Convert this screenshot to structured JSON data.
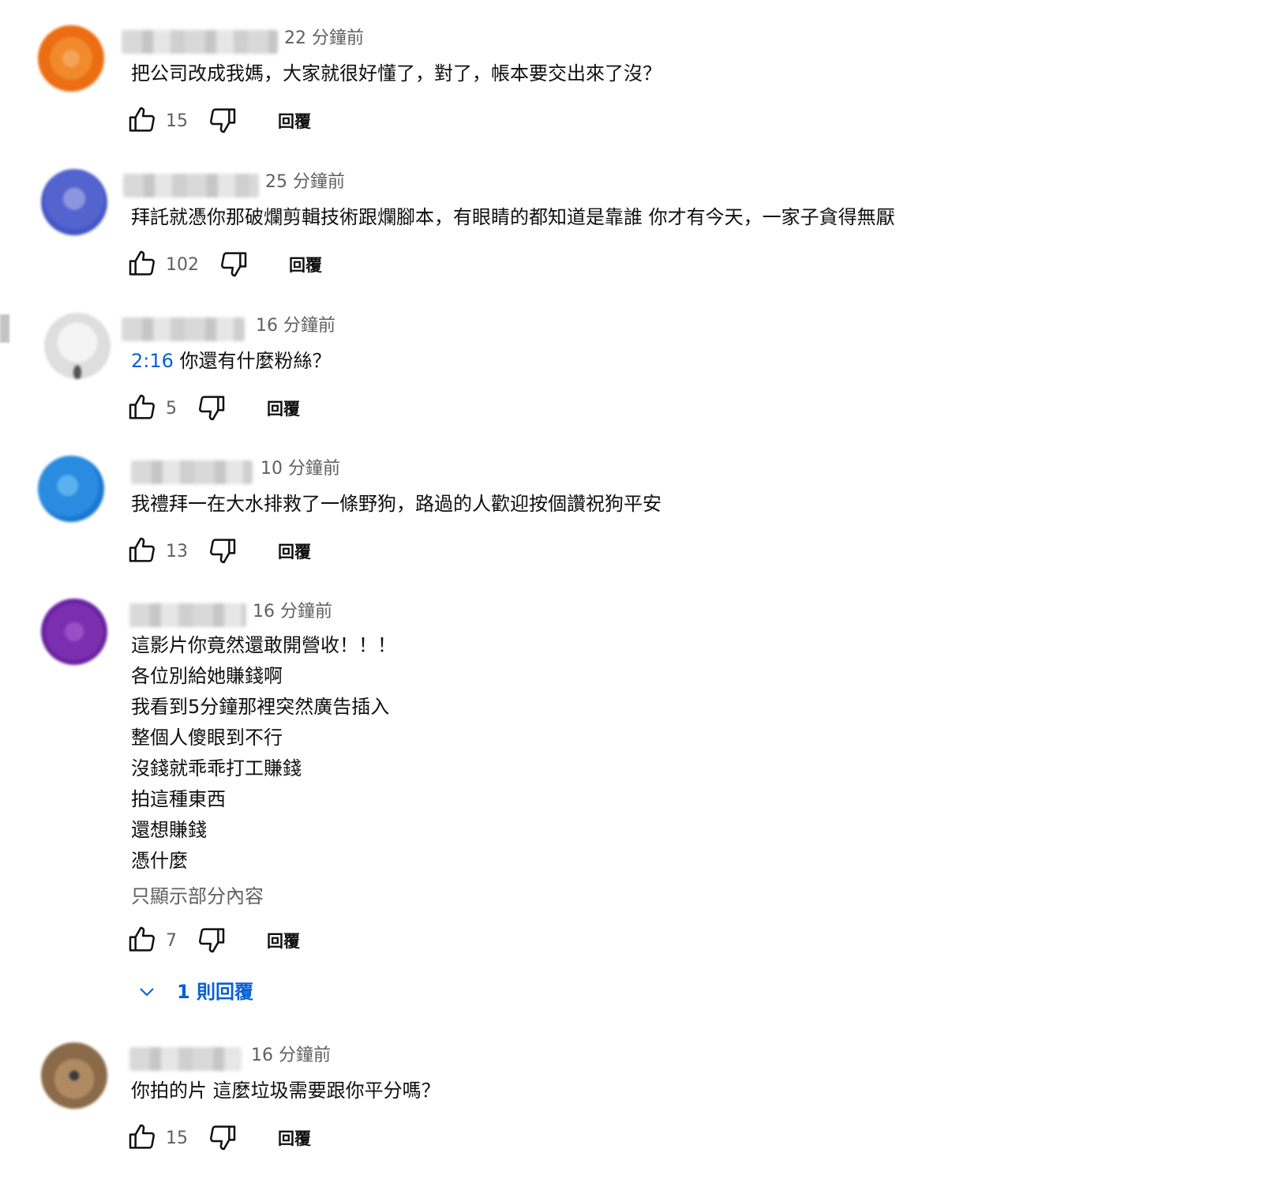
{
  "ui": {
    "reply_label": "回覆",
    "show_less_label": "只顯示部分內容",
    "link_color": "#065fd4",
    "secondary_text_color": "#606060"
  },
  "comments": [
    {
      "time": "22 分鐘前",
      "lines": [
        "把公司改成我媽，大家就很好懂了，對了，帳本要交出來了沒？"
      ],
      "likes": "15",
      "avatar_color": "#f07a1a"
    },
    {
      "time": "25 分鐘前",
      "lines": [
        "拜託就憑你那破爛剪輯技術跟爛腳本，有眼睛的都知道是靠誰 你才有今天，一家子貪得無厭"
      ],
      "likes": "102",
      "avatar_color": "#5b6bd0"
    },
    {
      "time": "16 分鐘前",
      "timestamp_link": "2:16",
      "lines": [
        "你還有什麼粉絲？"
      ],
      "likes": "5",
      "avatar_color": "#e4e4e4"
    },
    {
      "time": "10 分鐘前",
      "lines": [
        "我禮拜一在大水排救了一條野狗，路過的人歡迎按個讚祝狗平安"
      ],
      "likes": "13",
      "avatar_color": "#2b8fe0"
    },
    {
      "time": "16 分鐘前",
      "lines": [
        "這影片你竟然還敢開營收！！！",
        "各位別給她賺錢啊",
        "我看到5分鐘那裡突然廣告插入",
        "整個人傻眼到不行",
        "沒錢就乖乖打工賺錢",
        "拍這種東西",
        "還想賺錢",
        "憑什麼"
      ],
      "likes": "7",
      "replies_label": "1 則回覆",
      "avatar_color": "#7b2fb0"
    },
    {
      "time": "16 分鐘前",
      "lines": [
        "你拍的片 這麼垃圾需要跟你平分嗎？"
      ],
      "likes": "15",
      "avatar_color": "#9a7a55"
    }
  ]
}
